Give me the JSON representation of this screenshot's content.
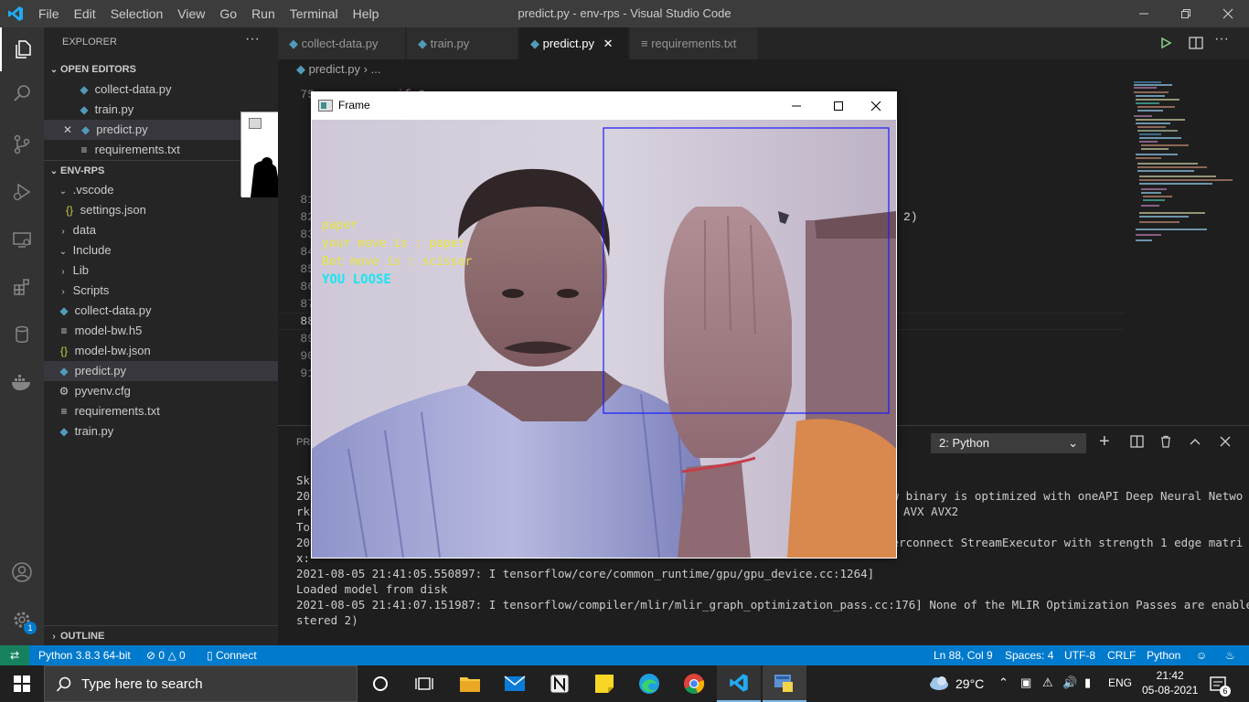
{
  "window": {
    "title": "predict.py - env-rps - Visual Studio Code",
    "menu": [
      "File",
      "Edit",
      "Selection",
      "View",
      "Go",
      "Run",
      "Terminal",
      "Help"
    ]
  },
  "sidebar": {
    "header": "EXPLORER",
    "more": "···",
    "open_editors_label": "OPEN EDITORS",
    "open_editors": [
      {
        "name": "collect-data.py",
        "icon": "python-icon"
      },
      {
        "name": "train.py",
        "icon": "python-icon"
      },
      {
        "name": "predict.py",
        "icon": "python-icon"
      },
      {
        "name": "requirements.txt",
        "icon": "text-file-icon"
      }
    ],
    "project_label": "ENV-RPS",
    "tree": [
      {
        "name": ".vscode",
        "type": "folder-open"
      },
      {
        "name": "settings.json",
        "type": "json"
      },
      {
        "name": "data",
        "type": "folder"
      },
      {
        "name": "Include",
        "type": "folder-open"
      },
      {
        "name": "Lib",
        "type": "folder"
      },
      {
        "name": "Scripts",
        "type": "folder"
      },
      {
        "name": "collect-data.py",
        "type": "python"
      },
      {
        "name": "model-bw.h5",
        "type": "text"
      },
      {
        "name": "model-bw.json",
        "type": "json"
      },
      {
        "name": "predict.py",
        "type": "python"
      },
      {
        "name": "pyvenv.cfg",
        "type": "gear"
      },
      {
        "name": "requirements.txt",
        "type": "text"
      },
      {
        "name": "train.py",
        "type": "python"
      }
    ],
    "outline_label": "OUTLINE",
    "badge": "1"
  },
  "tabs": [
    {
      "label": "collect-data.py"
    },
    {
      "label": "train.py"
    },
    {
      "label": "predict.py"
    },
    {
      "label": "requirements.txt"
    }
  ],
  "breadcrumb": {
    "file": "predict.py",
    "rest": "..."
  },
  "editor": {
    "line_numbers": [
      "75",
      "81",
      "82",
      "83",
      "84",
      "85",
      "86",
      "87",
      "88",
      "89",
      "90",
      "91"
    ],
    "visible_code_fragment": "2)",
    "top_fragment": "if   0"
  },
  "panel": {
    "tab_fragment": "PRO",
    "terminal_select": "2: Python",
    "lines_left": [
      "Sk",
      "202",
      "rk",
      "To",
      "202",
      "x:"
    ],
    "lines_right": [
      "ow binary is optimized with oneAPI Deep Neural Netwo",
      "AVX AVX2",
      "terconnect StreamExecutor with strength 1 edge matri"
    ],
    "lines_full": [
      "2021-08-05 21:41:05.550897: I tensorflow/core/common_runtime/gpu/gpu_device.cc:1264]",
      "Loaded model from disk",
      "2021-08-05 21:41:07.151987: I tensorflow/compiler/mlir/mlir_graph_optimization_pass.cc:176] None of the MLIR Optimization Passes are enabled (regi",
      "stered 2)"
    ]
  },
  "status": {
    "python": "Python 3.8.3 64-bit",
    "errors": "0",
    "warnings": "0",
    "connect": "Connect",
    "position": "Ln 88, Col 9",
    "spaces": "Spaces: 4",
    "encoding": "UTF-8",
    "eol": "CRLF",
    "language": "Python"
  },
  "frame": {
    "title": "Frame",
    "overlay": {
      "prediction": "paper",
      "your_move": "your move is : paper",
      "bot_move": "Bot move is : scissor",
      "result": "YOU LOOSE"
    }
  },
  "taskbar": {
    "search_placeholder": "Type here to search",
    "temperature": "29°C",
    "language": "ENG",
    "time": "21:42",
    "date": "05-08-2021",
    "notifications": "6"
  },
  "colors": {
    "status_bar": "#007acc",
    "overlay_yellow": "#e8e83c",
    "overlay_cyan": "#19e6f0",
    "roi_box": "#1a1aff"
  }
}
